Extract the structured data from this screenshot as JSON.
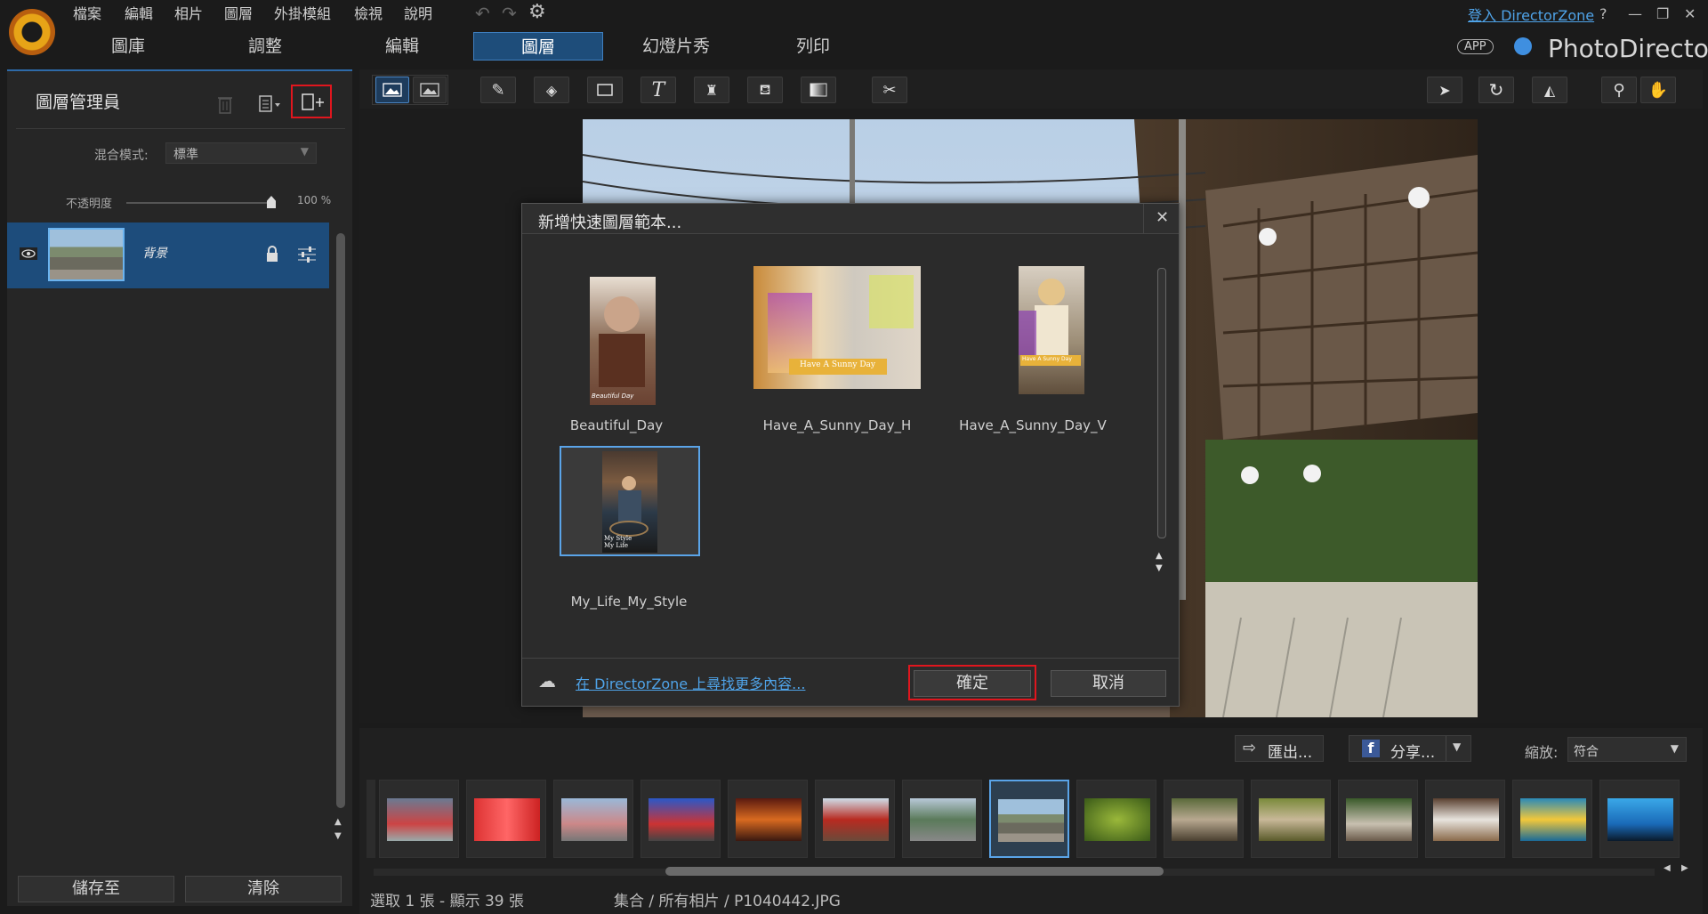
{
  "menu": [
    "檔案",
    "編輯",
    "相片",
    "圖層",
    "外掛模組",
    "檢視",
    "說明"
  ],
  "tabs": [
    {
      "label": "圖庫",
      "active": false
    },
    {
      "label": "調整",
      "active": false
    },
    {
      "label": "編輯",
      "active": false
    },
    {
      "label": "圖層",
      "active": true
    },
    {
      "label": "幻燈片秀",
      "active": false
    },
    {
      "label": "列印",
      "active": false
    }
  ],
  "header": {
    "login_link": "登入 DirectorZone",
    "help": "?",
    "app_badge": "APP",
    "brand": "PhotoDirector"
  },
  "left_panel": {
    "title": "圖層管理員",
    "blend_label": "混合模式:",
    "blend_value": "標準",
    "opacity_label": "不透明度",
    "opacity_value": "100 %",
    "opacity_fraction": 1.0,
    "layer_name": "背景",
    "save_button": "儲存至",
    "clear_button": "清除"
  },
  "dialog": {
    "title": "新增快速圖層範本...",
    "templates": [
      {
        "name": "Beautiful_Day",
        "caption": "Beautiful Day",
        "selected": false
      },
      {
        "name": "Have_A_Sunny_Day_H",
        "caption": "Have A Sunny Day",
        "selected": false
      },
      {
        "name": "Have_A_Sunny_Day_V",
        "caption": "Have A Sunny Day",
        "selected": false
      },
      {
        "name": "My_Life_My_Style",
        "caption": "My Style My Life",
        "selected": true
      }
    ],
    "more_link": "在 DirectorZone 上尋找更多內容...",
    "ok_button": "確定",
    "cancel_button": "取消"
  },
  "bottom": {
    "export_button": "匯出...",
    "share_button": "分享...",
    "zoom_label": "縮放:",
    "zoom_value": "符合",
    "status_selection": "選取 1 張 - 顯示 39 張",
    "status_path": "集合 / 所有相片 / P1040442.JPG"
  },
  "colors": {
    "accent": "#2e6aa8",
    "highlight_red": "#e0161e",
    "selected_blue": "#5aa4e8"
  }
}
